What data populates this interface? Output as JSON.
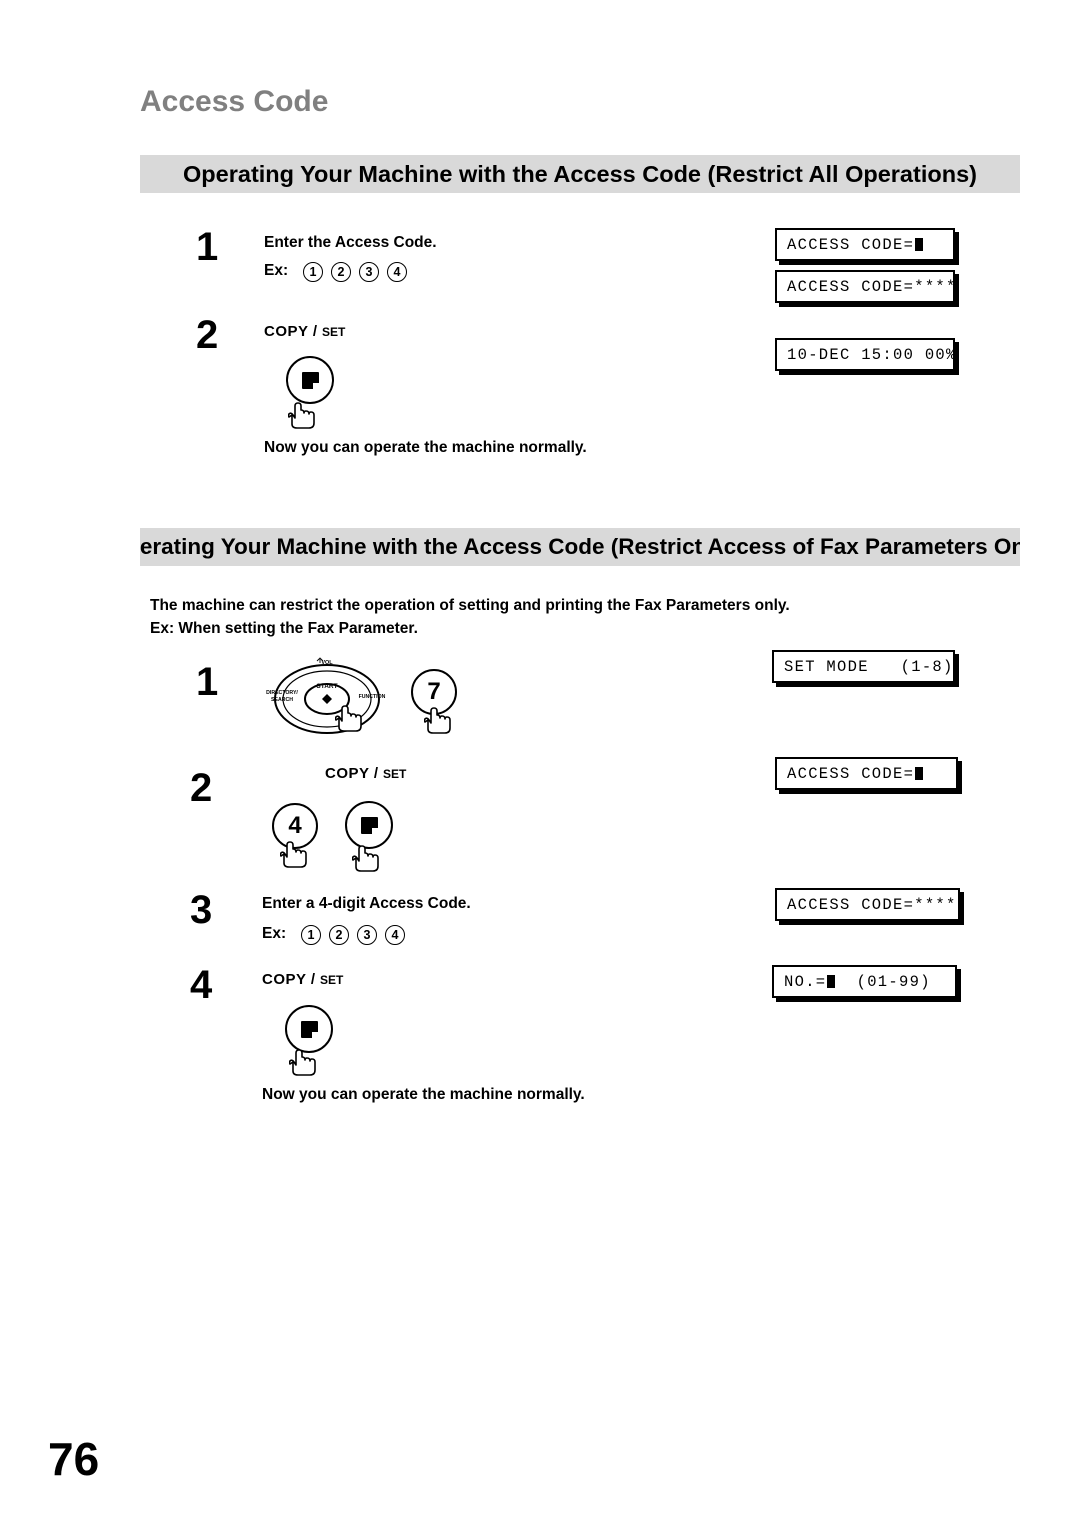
{
  "document": {
    "title": "Access Code",
    "page_number": "76"
  },
  "sections": [
    {
      "banner": "Operating Your Machine with the Access Code (Restrict All Operations)",
      "steps": [
        {
          "number": "1",
          "instruction": "Enter the Access Code.",
          "ex_label": "Ex:",
          "keys": [
            "1",
            "2",
            "3",
            "4"
          ]
        },
        {
          "number": "2",
          "button_label_big": "COPY /",
          "button_label_small": "SET"
        }
      ],
      "closing_text": "Now you can operate the machine normally.",
      "displays": [
        {
          "text": "ACCESS CODE=",
          "cursor": true
        },
        {
          "text": "ACCESS CODE=****",
          "cursor": false
        },
        {
          "text": "10-DEC 15:00 00%",
          "cursor": false
        }
      ]
    },
    {
      "banner": "Operating Your Machine with the Access Code (Restrict Access of Fax Parameters Only)",
      "intro_line1": "The machine can restrict the operation of setting and printing the Fax Parameters only.",
      "intro_line2": "Ex: When setting the Fax Parameter.",
      "steps": [
        {
          "number": "1",
          "key": "7",
          "panel_labels": {
            "vol": "VOL",
            "start": "START",
            "function": "FUNCTION",
            "directory": "DIRECTORY/",
            "search": "SEARCH"
          }
        },
        {
          "number": "2",
          "key": "4",
          "button_label_big": "COPY /",
          "button_label_small": "SET"
        },
        {
          "number": "3",
          "instruction": "Enter a 4-digit Access Code.",
          "ex_label": "Ex:",
          "keys": [
            "1",
            "2",
            "3",
            "4"
          ]
        },
        {
          "number": "4",
          "button_label_big": "COPY /",
          "button_label_small": "SET"
        }
      ],
      "closing_text": "Now you can operate the machine normally.",
      "displays": [
        {
          "text": "SET MODE   (1-8)",
          "cursor": false
        },
        {
          "text": "ACCESS CODE=",
          "cursor": true
        },
        {
          "text": "ACCESS CODE=****",
          "cursor": false
        },
        {
          "text": "NO.=",
          "suffix": "  (01-99)",
          "cursor": true
        }
      ]
    }
  ]
}
